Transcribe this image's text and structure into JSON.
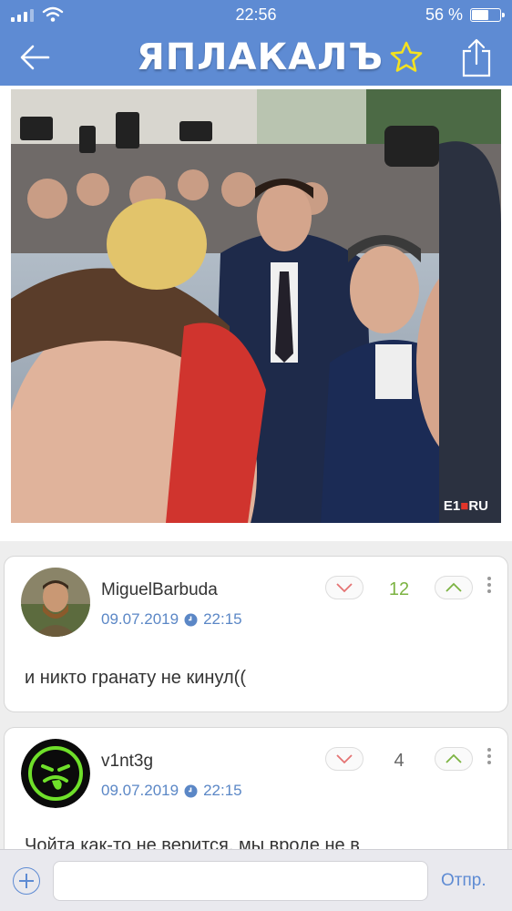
{
  "status_bar": {
    "time": "22:56",
    "battery_percent": "56 %",
    "battery_level": 0.56,
    "signal_icon": "cellular-signal-icon",
    "wifi_icon": "wifi-icon"
  },
  "nav": {
    "logo_text": "ЯПЛАКАЛЪ",
    "back_icon": "back-arrow-icon",
    "favorite_icon": "star-icon",
    "share_icon": "share-icon"
  },
  "photo": {
    "watermark_prefix": "E1",
    "watermark_mark": "■",
    "watermark_suffix": "RU"
  },
  "comments": [
    {
      "author": "MiguelBarbuda",
      "date": "09.07.2019",
      "time": "22:15",
      "score": "12",
      "score_color": "#7cb342",
      "text": "и никто гранату не кинул(("
    },
    {
      "author": "v1nt3g",
      "date": "09.07.2019",
      "time": "22:15",
      "score": "4",
      "score_color": "#666666",
      "text": "Чойта как-то не верится, мы вроде не в"
    }
  ],
  "input_bar": {
    "placeholder": "",
    "send_label": "Отпр."
  },
  "colors": {
    "header_blue": "#5e8bd3",
    "star_yellow": "#f4e11f",
    "downvote_red": "#e57373",
    "upvote_green": "#7cb342"
  }
}
